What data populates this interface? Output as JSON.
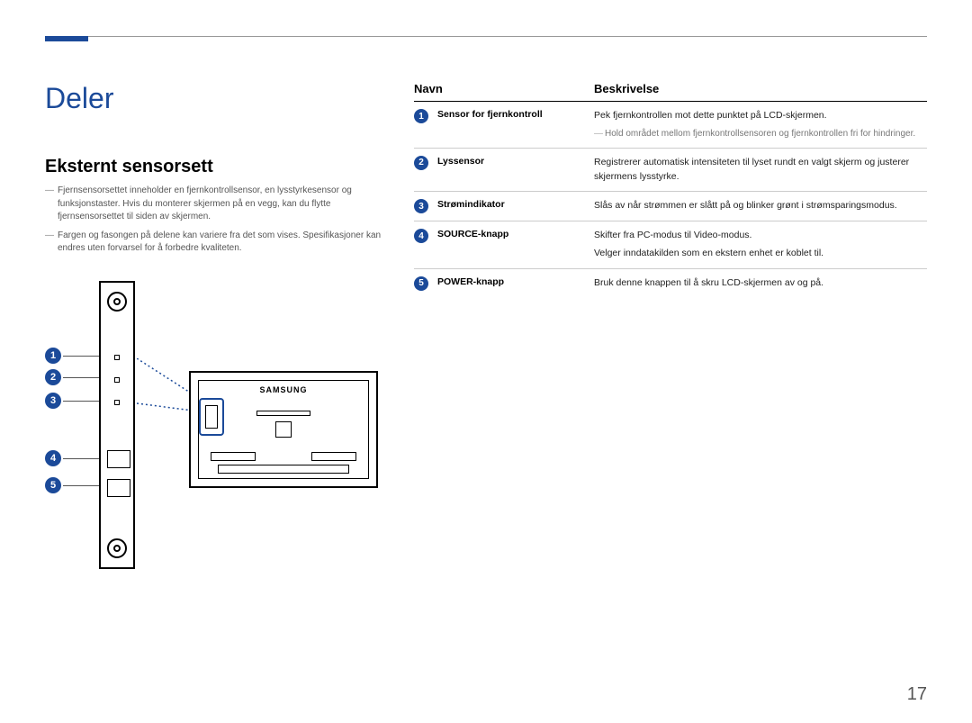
{
  "page_number": "17",
  "heading": "Deler",
  "subheading": "Eksternt sensorsett",
  "notes": [
    "Fjernsensorsettet inneholder en fjernkontrollsensor, en lysstyrkesensor og funksjonstaster. Hvis du monterer skjermen på en vegg, kan du flytte fjernsensorsettet til siden av skjermen.",
    "Fargen og fasongen på delene kan variere fra det som vises. Spesifikasjoner kan endres uten forvarsel for å forbedre kvaliteten."
  ],
  "monitor_brand": "SAMSUNG",
  "table": {
    "header_name": "Navn",
    "header_desc": "Beskrivelse",
    "rows": [
      {
        "n": "1",
        "name": "Sensor for fjernkontroll",
        "desc": "Pek fjernkontrollen mot dette punktet på LCD-skjermen.",
        "sub": "Hold området mellom fjernkontrollsensoren og fjernkontrollen fri for hindringer."
      },
      {
        "n": "2",
        "name": "Lyssensor",
        "desc": "Registrerer automatisk intensiteten til lyset rundt en valgt skjerm og justerer skjermens lysstyrke."
      },
      {
        "n": "3",
        "name": "Strømindikator",
        "desc": "Slås av når strømmen er slått på og blinker grønt i strømsparingsmodus."
      },
      {
        "n": "4",
        "name": "SOURCE-knapp",
        "desc": "Skifter fra PC-modus til Video-modus.",
        "second": "Velger inndatakilden som en ekstern enhet er koblet til."
      },
      {
        "n": "5",
        "name": "POWER-knapp",
        "desc": "Bruk denne knappen til å skru LCD-skjermen av og på."
      }
    ]
  }
}
